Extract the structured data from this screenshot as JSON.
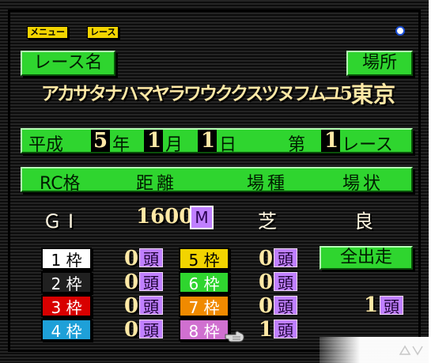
{
  "menu": {
    "menu_label": "メニュー",
    "race_label": "レース"
  },
  "race_name": {
    "label": "レース名",
    "value": "アカサタナハマヤラワウククスツヌフムユ5"
  },
  "venue": {
    "label": "場所",
    "value": "東京"
  },
  "date": {
    "era": "平成",
    "year_num": "5",
    "year_unit": "年",
    "month_num": "1",
    "month_unit": "月",
    "day_num": "1",
    "day_unit": "日",
    "dai": "第",
    "race_num": "1",
    "race_unit": "レース"
  },
  "headers": {
    "rc_grade": "RC格",
    "distance": "距離",
    "track_type": "場種",
    "condition": "場状"
  },
  "values": {
    "grade": "ＧⅠ",
    "distance_num": "1600",
    "distance_unit": "M",
    "track": "芝",
    "condition": "良"
  },
  "frames": [
    {
      "label": "1 枠",
      "count": "0",
      "unit": "頭",
      "color": "#ffffff",
      "text_color": "#000000"
    },
    {
      "label": "2 枠",
      "count": "0",
      "unit": "頭",
      "color": "#202020",
      "text_color": "#ffffff"
    },
    {
      "label": "3 枠",
      "count": "0",
      "unit": "頭",
      "color": "#d80000",
      "text_color": "#ffffff"
    },
    {
      "label": "4 枠",
      "count": "0",
      "unit": "頭",
      "color": "#1ea0d8",
      "text_color": "#ffffff"
    },
    {
      "label": "5 枠",
      "count": "0",
      "unit": "頭",
      "color": "#f2d400",
      "text_color": "#000000"
    },
    {
      "label": "6 枠",
      "count": "0",
      "unit": "頭",
      "color": "#2fd52f",
      "text_color": "#ffffff"
    },
    {
      "label": "7 枠",
      "count": "0",
      "unit": "頭",
      "color": "#f08a00",
      "text_color": "#ffffff"
    },
    {
      "label": "8 枠",
      "count": "1",
      "unit": "頭",
      "color": "#d070d0",
      "text_color": "#ffffff"
    }
  ],
  "all_entries": {
    "label": "全出走"
  },
  "total": {
    "num": "1",
    "unit": "頭"
  },
  "icons": {
    "status": "circle-indicator-icon",
    "cursor": "pointing-hand-icon"
  }
}
